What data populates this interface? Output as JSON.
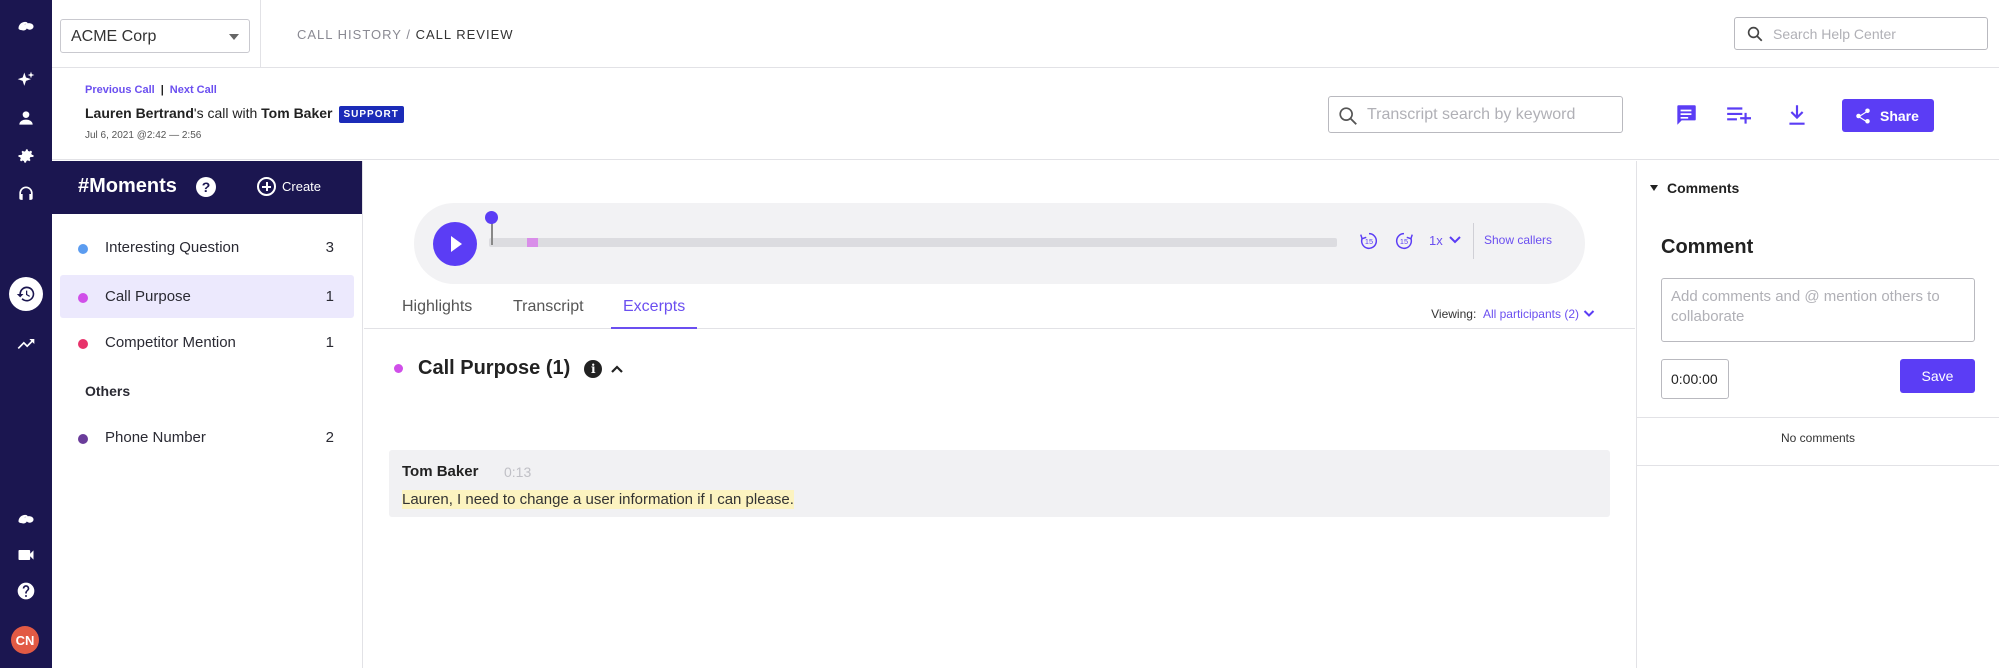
{
  "org": {
    "name": "ACME Corp"
  },
  "breadcrumb": {
    "parent": "CALL HISTORY",
    "separator": " / ",
    "current": "CALL REVIEW"
  },
  "help_search": {
    "placeholder": "Search Help Center"
  },
  "call": {
    "prev_label": "Previous Call",
    "link_separator": "|",
    "next_label": "Next Call",
    "agent": "Lauren Bertrand",
    "connector": "'s call with ",
    "customer": "Tom Baker",
    "tag": "SUPPORT",
    "date": "Jul 6, 2021 @2:42 — 2:56"
  },
  "transcript_search": {
    "placeholder": "Transcript search by keyword"
  },
  "actions": {
    "share_label": "Share"
  },
  "moments": {
    "title": "#Moments",
    "help_glyph": "?",
    "create_label": "Create",
    "items": [
      {
        "label": "Interesting Question",
        "count": "3",
        "color": "#5b9cf0"
      },
      {
        "label": "Call Purpose",
        "count": "1",
        "color": "#d04fe9"
      },
      {
        "label": "Competitor Mention",
        "count": "1",
        "color": "#e8336b"
      }
    ],
    "others_label": "Others",
    "others": [
      {
        "label": "Phone Number",
        "count": "2",
        "color": "#6a3c9a"
      }
    ]
  },
  "player": {
    "progress_fraction": 0.0,
    "clip_fraction": 0.045,
    "skip_back_label": "15",
    "skip_fwd_label": "15",
    "speed": "1x",
    "show_callers_label": "Show callers"
  },
  "tabs": [
    {
      "label": "Highlights",
      "active": false
    },
    {
      "label": "Transcript",
      "active": false
    },
    {
      "label": "Excerpts",
      "active": true
    }
  ],
  "viewing": {
    "label": "Viewing:",
    "value": "All participants (2)"
  },
  "section": {
    "title": "Call Purpose (1)",
    "color": "#d04fe9",
    "info_glyph": "i"
  },
  "excerpt": {
    "speaker": "Tom Baker",
    "time": "0:13",
    "text": "Lauren, I need to change a user information if I can please."
  },
  "comments": {
    "toggle_label": "Comments",
    "title": "Comment",
    "placeholder": "Add comments and @ mention others to collaborate",
    "time_value": "0:00:00",
    "save_label": "Save",
    "empty_label": "No comments"
  },
  "user": {
    "initials": "CN"
  },
  "colors": {
    "accent": "#5b3df5",
    "sidebar": "#1b1650",
    "tag": "#1b2bb8",
    "highlight": "#fcf3c0"
  }
}
